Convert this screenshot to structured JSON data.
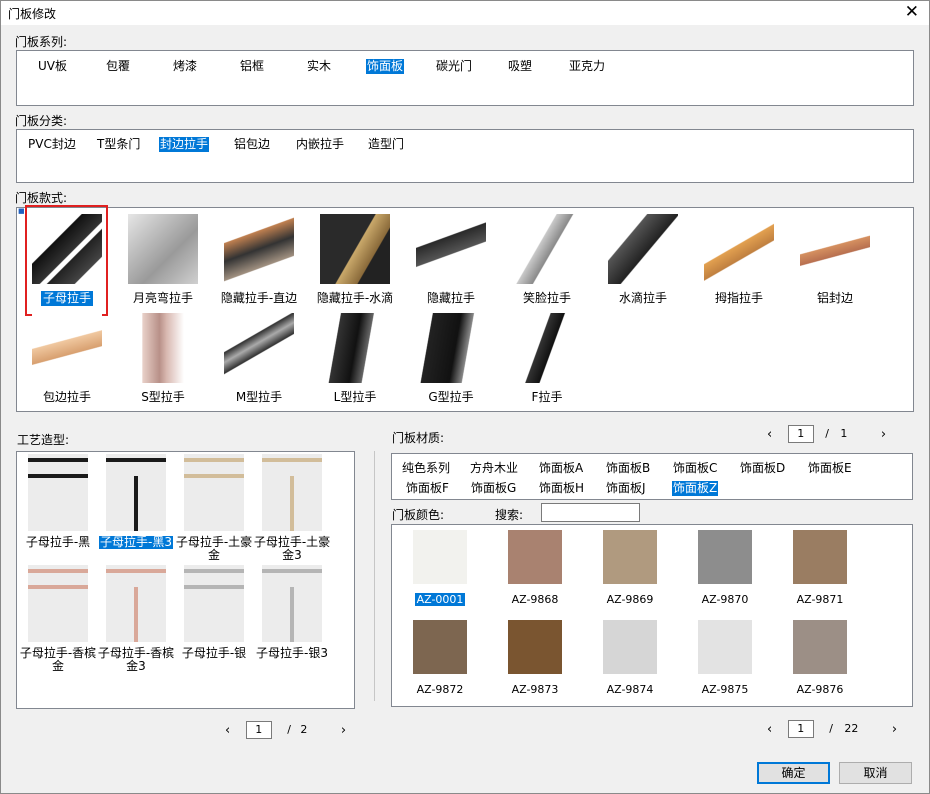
{
  "window": {
    "title": "门板修改",
    "close_glyph": "✕"
  },
  "series": {
    "label": "门板系列:",
    "items": [
      "UV板",
      "包覆",
      "烤漆",
      "铝框",
      "实木",
      "饰面板",
      "碳光门",
      "吸塑",
      "亚克力"
    ],
    "selected_index": 5
  },
  "category": {
    "label": "门板分类:",
    "items": [
      "PVC封边",
      "T型条门",
      "封边拉手",
      "铝包边",
      "内嵌拉手",
      "造型门"
    ],
    "selected_index": 2
  },
  "style": {
    "label": "门板款式:",
    "collapse_glyph": "■",
    "items": [
      {
        "name": "子母拉手",
        "icon": "black-split-handle"
      },
      {
        "name": "月亮弯拉手",
        "icon": "silver-curved-handle"
      },
      {
        "name": "隐藏拉手-直边",
        "icon": "hidden-handle-straight"
      },
      {
        "name": "隐藏拉手-水滴",
        "icon": "hidden-handle-drop"
      },
      {
        "name": "隐藏拉手",
        "icon": "hidden-handle"
      },
      {
        "name": "笑脸拉手",
        "icon": "smile-handle"
      },
      {
        "name": "水滴拉手",
        "icon": "drop-handle"
      },
      {
        "name": "拇指拉手",
        "icon": "thumb-handle"
      },
      {
        "name": "铝封边",
        "icon": "aluminium-edge"
      },
      {
        "name": "包边拉手",
        "icon": "wrap-edge-handle"
      },
      {
        "name": "S型拉手",
        "icon": "s-handle"
      },
      {
        "name": "M型拉手",
        "icon": "m-handle"
      },
      {
        "name": "L型拉手",
        "icon": "l-handle"
      },
      {
        "name": "G型拉手",
        "icon": "g-handle"
      },
      {
        "name": "F拉手",
        "icon": "f-handle"
      }
    ],
    "selected_index": 0
  },
  "craft": {
    "label": "工艺造型:",
    "items": [
      {
        "name": "子母拉手-黑",
        "color": "#1a1a1a",
        "vertical": false
      },
      {
        "name": "子母拉手-黑3",
        "color": "#1a1a1a",
        "vertical": true
      },
      {
        "name": "子母拉手-土豪金",
        "color": "#d2bd9a",
        "vertical": false
      },
      {
        "name": "子母拉手-土豪金3",
        "color": "#d2bd9a",
        "vertical": true
      },
      {
        "name": "子母拉手-香槟金",
        "color": "#d9a899",
        "vertical": false
      },
      {
        "name": "子母拉手-香槟金3",
        "color": "#d9a899",
        "vertical": true
      },
      {
        "name": "子母拉手-银",
        "color": "#b5b5b5",
        "vertical": false
      },
      {
        "name": "子母拉手-银3",
        "color": "#b5b5b5",
        "vertical": true
      }
    ],
    "selected_index": 1,
    "pager": {
      "current": "1",
      "sep": "/",
      "total": "2",
      "prev": "‹",
      "next": "›"
    }
  },
  "material": {
    "label": "门板材质:",
    "top_pager": {
      "current": "1",
      "sep": "/",
      "total": "1",
      "prev": "‹",
      "next": "›"
    },
    "items": [
      "纯色系列",
      "方舟木业",
      "饰面板A",
      "饰面板B",
      "饰面板C",
      "饰面板D",
      "饰面板E",
      "饰面板F",
      "饰面板G",
      "饰面板H",
      "饰面板J",
      "饰面板Z"
    ],
    "selected_index": 11
  },
  "color": {
    "label": "门板颜色:",
    "search_label": "搜索:",
    "search_value": "",
    "swatches": [
      {
        "code": "AZ-0001",
        "color": "#f2f2ee"
      },
      {
        "code": "AZ-9868",
        "color": "#a98270"
      },
      {
        "code": "AZ-9869",
        "color": "#b09a7f"
      },
      {
        "code": "AZ-9870",
        "color": "#8d8d8d"
      },
      {
        "code": "AZ-9871",
        "color": "#9a7d62"
      },
      {
        "code": "AZ-9872",
        "color": "#7d6650"
      },
      {
        "code": "AZ-9873",
        "color": "#7a5530"
      },
      {
        "code": "AZ-9874",
        "color": "#d6d6d6"
      },
      {
        "code": "AZ-9875",
        "color": "#e3e3e3"
      },
      {
        "code": "AZ-9876",
        "color": "#9c8f86"
      }
    ],
    "selected_index": 0,
    "pager": {
      "current": "1",
      "sep": "/",
      "total": "22",
      "prev": "‹",
      "next": "›"
    }
  },
  "buttons": {
    "ok": "确定",
    "cancel": "取消"
  },
  "accent": "#0078d7"
}
